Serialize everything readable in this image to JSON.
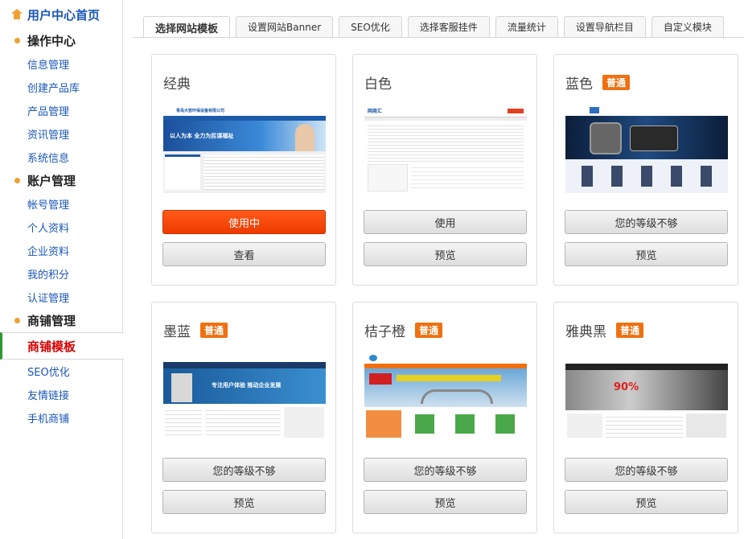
{
  "sidebar": {
    "home": "用户中心首页",
    "sections": [
      {
        "title": "操作中心",
        "items": [
          "信息管理",
          "创建产品库",
          "产品管理",
          "资讯管理",
          "系统信息"
        ]
      },
      {
        "title": "账户管理",
        "items": [
          "帐号管理",
          "个人资料",
          "企业资料",
          "我的积分",
          "认证管理"
        ]
      },
      {
        "title": "商铺管理",
        "items": [
          "商铺模板",
          "SEO优化",
          "友情链接",
          "手机商铺"
        ]
      }
    ],
    "active_item": "商铺模板"
  },
  "tabs": [
    "选择网站模板",
    "设置网站Banner",
    "SEO优化",
    "选择客服挂件",
    "流量统计",
    "设置导航栏目",
    "自定义模块"
  ],
  "templates": [
    {
      "name": "经典",
      "badge": "",
      "btn1": "使用中",
      "btn2": "查看",
      "thumb_title": "青岛大容环保设备有限公司",
      "thumb_slogan": "以人为本 全力为民谋福祉"
    },
    {
      "name": "白色",
      "badge": "",
      "btn1": "使用",
      "btn2": "预览",
      "thumb_title": "网商汇",
      "thumb_slogan": ""
    },
    {
      "name": "蓝色",
      "badge": "普通",
      "btn1": "您的等级不够",
      "btn2": "预览",
      "thumb_title": "",
      "thumb_slogan": ""
    },
    {
      "name": "墨蓝",
      "badge": "普通",
      "btn1": "您的等级不够",
      "btn2": "预览",
      "thumb_title": "",
      "thumb_slogan": "专注用户体验 推动企业发展"
    },
    {
      "name": "桔子橙",
      "badge": "普通",
      "btn1": "您的等级不够",
      "btn2": "预览",
      "thumb_title": "",
      "thumb_slogan": ""
    },
    {
      "name": "雅典黑",
      "badge": "普通",
      "btn1": "您的等级不够",
      "btn2": "预览",
      "thumb_title": "",
      "thumb_slogan": "90%"
    }
  ],
  "colors": {
    "accent_orange": "#f07010",
    "link_blue": "#1a57b8",
    "active_red": "#d80000",
    "active_green": "#2e9a2e"
  }
}
